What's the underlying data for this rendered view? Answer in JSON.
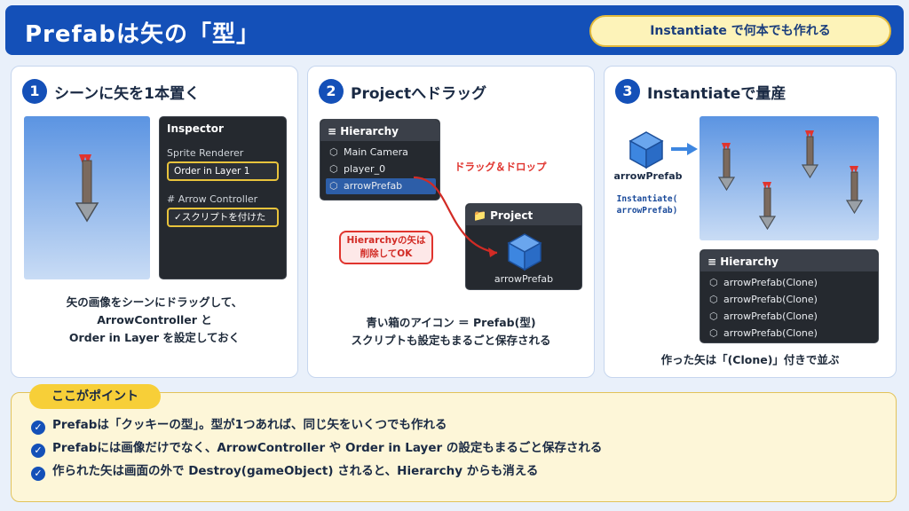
{
  "header": {
    "title": "Prefabは矢の「型」",
    "badge": "Instantiate で何本でも作れる"
  },
  "colors": {
    "primary": "#1450b8",
    "badge_bg": "#fdf3b9",
    "accent_red": "#e0342e",
    "highlight_yellow": "#e8c33c",
    "cube_blue": "#3d86e0"
  },
  "steps": [
    {
      "num": "1",
      "title": "シーンに矢を1本置く",
      "inspector": {
        "title": "Inspector",
        "sprite_renderer": "Sprite Renderer",
        "order_field": "Order in Layer    1",
        "component": "# Arrow Controller",
        "script_field": "✓スクリプトを付けた"
      },
      "caption": [
        "矢の画像をシーンにドラッグして、",
        "ArrowController と",
        "Order in Layer を設定しておく"
      ]
    },
    {
      "num": "2",
      "title": "Projectへドラッグ",
      "hierarchy": {
        "title": "≡ Hierarchy",
        "items": [
          "Main Camera",
          "player_0",
          "arrowPrefab"
        ]
      },
      "drag_label": "ドラッグ＆ドロップ",
      "project": {
        "title": "📁 Project",
        "item": "arrowPrefab"
      },
      "note": [
        "Hierarchyの矢は",
        "削除してOK"
      ],
      "caption": [
        "青い箱のアイコン ＝ Prefab(型)",
        "スクリプトも設定もまるごと保存される"
      ]
    },
    {
      "num": "3",
      "title": "Instantiateで量産",
      "prefab_label": "arrowPrefab",
      "code": [
        "Instantiate(",
        "arrowPrefab)"
      ],
      "hierarchy": {
        "title": "≡ Hierarchy",
        "items": [
          "arrowPrefab(Clone)",
          "arrowPrefab(Clone)",
          "arrowPrefab(Clone)",
          "arrowPrefab(Clone)"
        ]
      },
      "caption": [
        "作った矢は「(Clone)」付きで並ぶ"
      ]
    }
  ],
  "points": {
    "title": "ここがポイント",
    "items": [
      "Prefabは「クッキーの型」。型が1つあれば、同じ矢をいくつでも作れる",
      "Prefabには画像だけでなく、ArrowController や Order in Layer の設定もまるごと保存される",
      "作られた矢は画面の外で Destroy(gameObject) されると、Hierarchy からも消える"
    ]
  },
  "icons": [
    "check-icon",
    "hexagon-icon",
    "folder-icon",
    "cube-icon",
    "arrow-icon",
    "right-arrow-icon",
    "menu-icon"
  ]
}
